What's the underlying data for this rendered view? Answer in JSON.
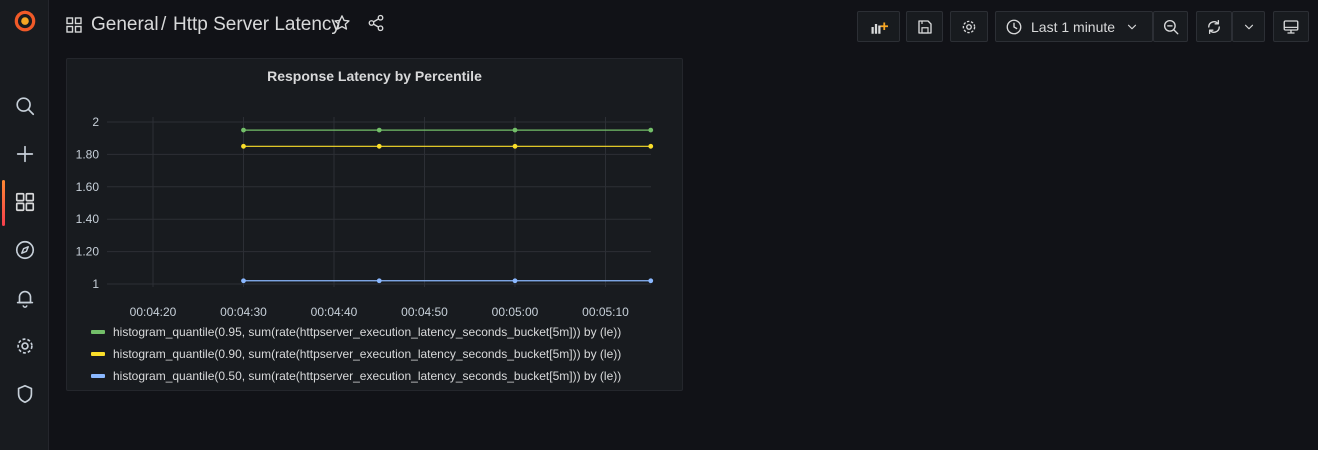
{
  "breadcrumb": {
    "folder": "General",
    "separator": "/",
    "dashboard": "Http Server Latency"
  },
  "toolbar": {
    "time_range": "Last 1 minute"
  },
  "colors": {
    "accent": "#f05a28",
    "series_p95": "#73bf69",
    "series_p90": "#fade2a",
    "series_p50": "#8ab8ff"
  },
  "panel": {
    "title": "Response Latency by Percentile"
  },
  "chart_data": {
    "type": "line",
    "title": "Response Latency by Percentile",
    "x_ticks": [
      "00:04:20",
      "00:04:30",
      "00:04:40",
      "00:04:50",
      "00:05:00",
      "00:05:10"
    ],
    "y_ticks": [
      "1",
      "1.20",
      "1.40",
      "1.60",
      "1.80",
      "2"
    ],
    "x": [
      "00:04:30",
      "00:04:45",
      "00:05:00",
      "00:05:15"
    ],
    "ylim": [
      1,
      2
    ],
    "grid": true,
    "legend_placement": "bottom",
    "series": [
      {
        "name": "histogram_quantile(0.95, sum(rate(httpserver_execution_latency_seconds_bucket[5m])) by (le))",
        "color": "#73bf69",
        "values": [
          1.95,
          1.95,
          1.95,
          1.95
        ]
      },
      {
        "name": "histogram_quantile(0.90, sum(rate(httpserver_execution_latency_seconds_bucket[5m])) by (le))",
        "color": "#fade2a",
        "values": [
          1.85,
          1.85,
          1.85,
          1.85
        ]
      },
      {
        "name": "histogram_quantile(0.50, sum(rate(httpserver_execution_latency_seconds_bucket[5m])) by (le))",
        "color": "#8ab8ff",
        "values": [
          1.02,
          1.02,
          1.02,
          1.02
        ]
      }
    ]
  }
}
